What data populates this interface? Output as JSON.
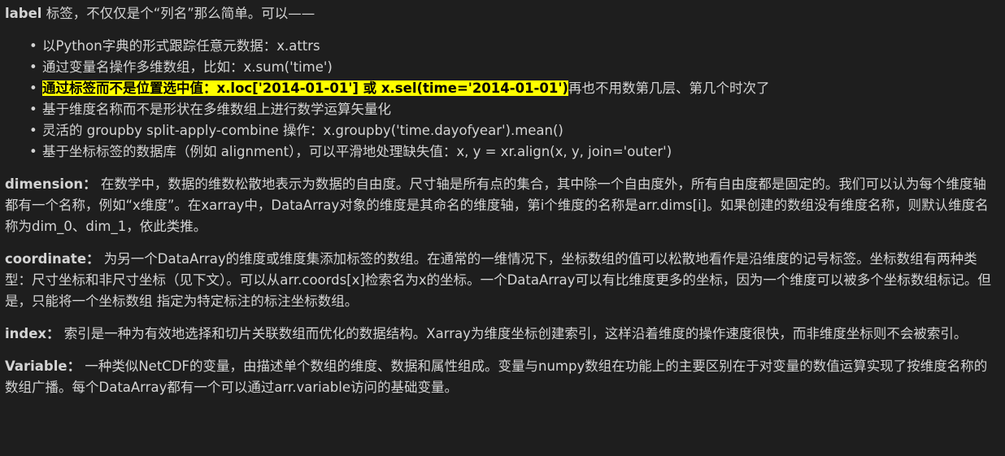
{
  "intro": {
    "term": "label",
    "text": " 标签，不仅仅是个“列名”那么简单。可以——"
  },
  "bullets": [
    {
      "text": "以Python字典的形式跟踪任意元数据：x.attrs"
    },
    {
      "text": "通过变量名操作多维数组，比如：x.sum('time')"
    },
    {
      "highlight": "通过标签而不是位置选中值：x.loc['2014-01-01'] 或 x.sel(time='2014-01-01')",
      "text": "再也不用数第几层、第几个时次了"
    },
    {
      "text": "基于维度名称而不是形状在多维数组上进行数学运算矢量化"
    },
    {
      "text": "灵活的 groupby split-apply-combine 操作：x.groupby('time.dayofyear').mean()"
    },
    {
      "text": "基于坐标标签的数据库（例如 alignment），可以平滑地处理缺失值：x, y = xr.align(x, y, join='outer')"
    }
  ],
  "paragraphs": [
    {
      "term": "dimension：",
      "text": " 在数学中，数据的维数松散地表示为数据的自由度。尺寸轴是所有点的集合，其中除一个自由度外，所有自由度都是固定的。我们可以认为每个维度轴都有一个名称，例如“x维度”。在xarray中，DataArray对象的维度是其命名的维度轴，第i个维度的名称是arr.dims[i]。如果创建的数组没有维度名称，则默认维度名称为dim_0、dim_1，依此类推。"
    },
    {
      "term": "coordinate：",
      "text": " 为另一个DataArray的维度或维度集添加标签的数组。在通常的一维情况下，坐标数组的值可以松散地看作是沿维度的记号标签。坐标数组有两种类型：尺寸坐标和非尺寸坐标（见下文）。可以从arr.coords[x]检索名为x的坐标。一个DataArray可以有比维度更多的坐标，因为一个维度可以被多个坐标数组标记。但是，只能将一个坐标数组 指定为特定标注的标注坐标数组。"
    },
    {
      "term": "index：",
      "text": " 索引是一种为有效地选择和切片关联数组而优化的数据结构。Xarray为维度坐标创建索引，这样沿着维度的操作速度很快，而非维度坐标则不会被索引。"
    },
    {
      "term": "Variable：",
      "text": " 一种类似NetCDF的变量，由描述单个数组的维度、数据和属性组成。变量与numpy数组在功能上的主要区别在于对变量的数值运算实现了按维度名称的数组广播。每个DataArray都有一个可以通过arr.variable访问的基础变量。"
    }
  ],
  "colors": {
    "background": "#1e1e1e",
    "text": "#d4d4d4",
    "highlight": "#ffff00"
  }
}
